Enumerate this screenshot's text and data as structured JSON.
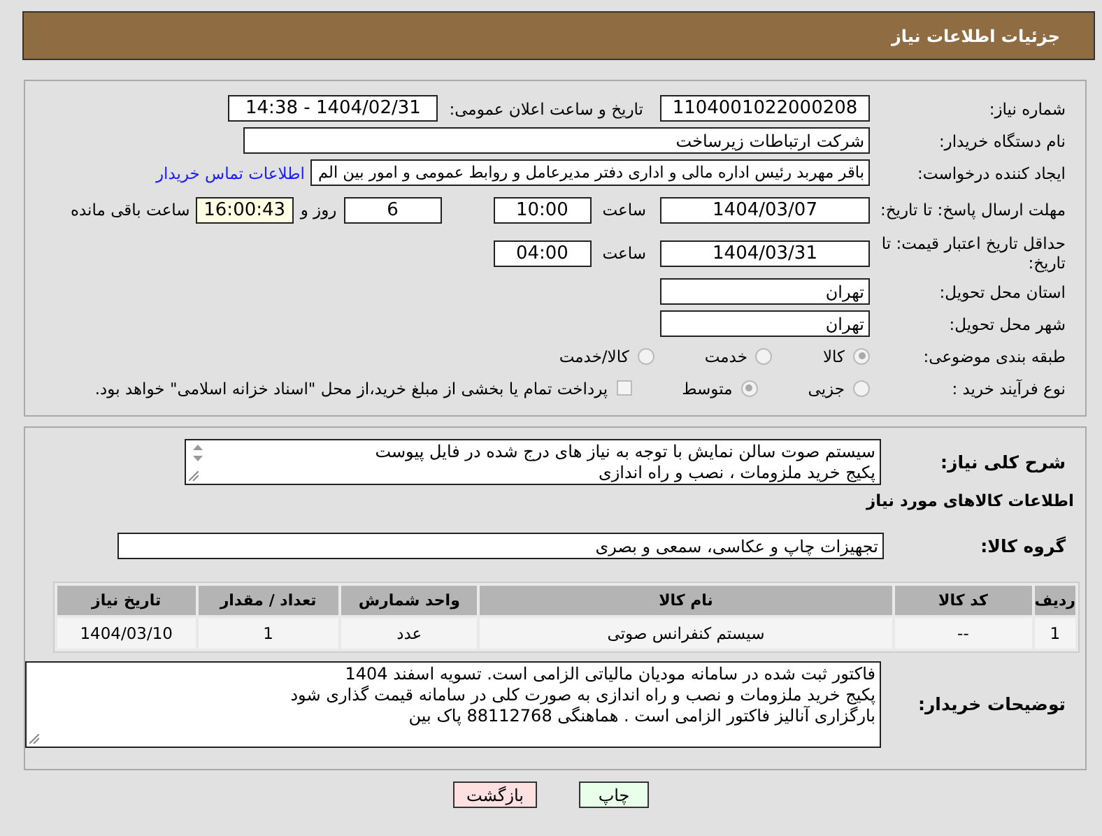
{
  "header": {
    "title": "جزئیات اطلاعات نیاز"
  },
  "details": {
    "need_number_label": "شماره نیاز:",
    "need_number": "1104001022000208",
    "announce_label": "تاریخ و ساعت اعلان عمومی:",
    "announce": "1404/02/31 - 14:38",
    "buyer_label": "نام دستگاه خریدار:",
    "buyer": "شرکت ارتباطات زیرساخت",
    "requester_label": "ایجاد کننده درخواست:",
    "requester": "باقر مهربد رئیس اداره مالی و اداری دفتر مدیرعامل و روابط عمومی و امور بین الم",
    "contact_link": "اطلاعات تماس خریدار",
    "deadline_label": "مهلت ارسال پاسخ: تا تاریخ:",
    "deadline_date": "1404/03/07",
    "time_label": "ساعت",
    "deadline_time": "10:00",
    "days": "6",
    "days_label": "روز و",
    "remaining": "16:00:43",
    "remaining_label": "ساعت باقی مانده",
    "validity_label": "حداقل تاریخ اعتبار قیمت: تا تاریخ:",
    "validity_date": "1404/03/31",
    "validity_time_label": "ساعت",
    "validity_time": "04:00",
    "province_label": "استان محل تحویل:",
    "province": "تهران",
    "city_label": "شهر محل تحویل:",
    "city": "تهران",
    "category_label": "طبقه بندی موضوعی:",
    "category_options": [
      {
        "label": "کالا",
        "selected": true
      },
      {
        "label": "خدمت",
        "selected": false
      },
      {
        "label": "کالا/خدمت",
        "selected": false
      }
    ],
    "process_label": "نوع فرآیند خرید :",
    "process_options": [
      {
        "label": "جزیی",
        "selected": false
      },
      {
        "label": "متوسط",
        "selected": true
      }
    ],
    "treasury": {
      "checked": false,
      "label": "پرداخت تمام یا بخشی از مبلغ خرید،از محل \"اسناد خزانه اسلامی\" خواهد بود."
    }
  },
  "goods": {
    "description_label": "شرح کلی نیاز:",
    "description": "سیستم صوت سالن نمایش با توجه به نیاز های درج شده در فایل پیوست\nپکیج خرید ملزومات ، نصب و راه اندازی",
    "section_title": "اطلاعات کالاهای مورد نیاز",
    "group_label": "گروه کالا:",
    "group": "تجهیزات چاپ و عکاسی، سمعی و بصری",
    "table": {
      "columns": [
        "ردیف",
        "کد کالا",
        "نام کالا",
        "واحد شمارش",
        "تعداد / مقدار",
        "تاریخ نیاز"
      ],
      "rows": [
        [
          "1",
          "--",
          "سیستم کنفرانس صوتی",
          "عدد",
          "1",
          "1404/03/10"
        ]
      ]
    },
    "notes_label": "توضیحات خریدار:",
    "notes": "فاکتور ثبت شده در سامانه مودیان مالیاتی الزامی است. تسویه اسفند 1404\nپکیج خرید ملزومات و نصب و راه اندازی به صورت کلی در سامانه قیمت گذاری شود\nبارگزاری آنالیز فاکتور الزامی است . هماهنگی 88112768 پاک بین"
  },
  "buttons": [
    {
      "label": "چاپ",
      "kind": "print"
    },
    {
      "label": "بازگشت",
      "kind": "back"
    }
  ]
}
